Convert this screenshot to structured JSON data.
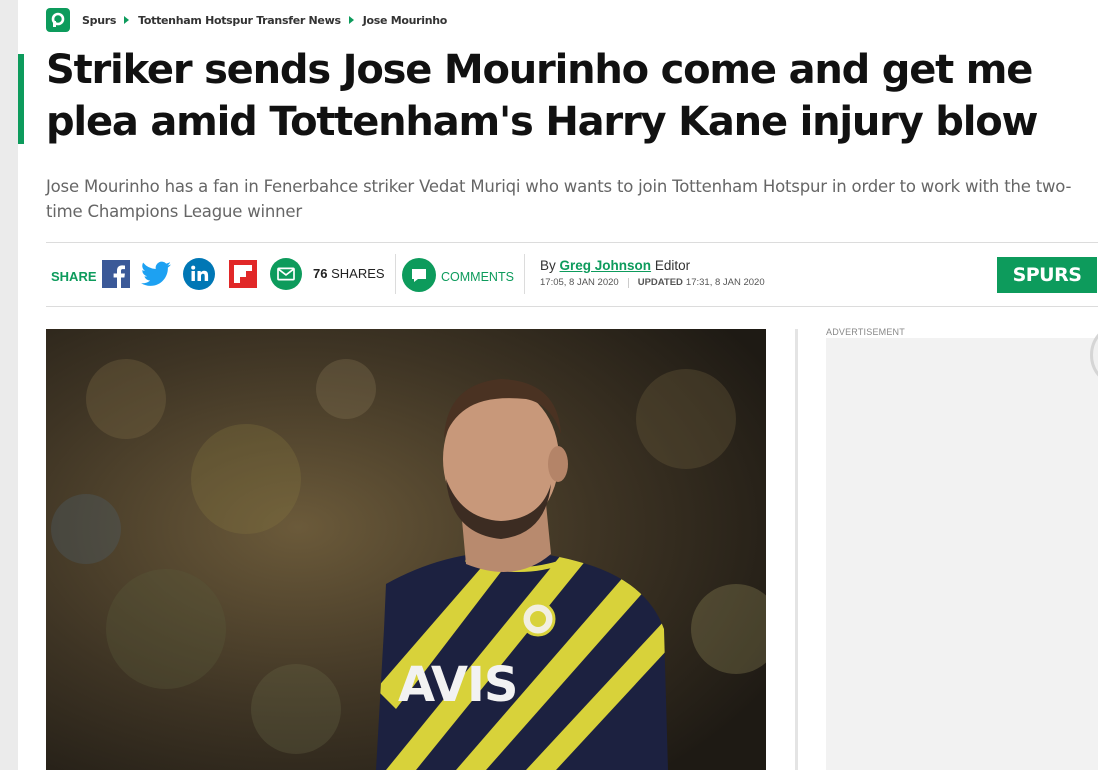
{
  "breadcrumb": {
    "items": [
      "Spurs",
      "Tottenham Hotspur Transfer News",
      "Jose Mourinho"
    ]
  },
  "article": {
    "headline": "Striker sends Jose Mourinho come and get me plea amid Tottenham's Harry Kane injury blow",
    "standfirst": "Jose Mourinho has a fan in Fenerbahce striker Vedat Muriqi who wants to join Tottenham Hotspur in order to work with the two-time Champions League winner"
  },
  "share": {
    "label": "SHARE",
    "count": "76",
    "count_suffix": "SHARES",
    "comments_label": "COMMENTS",
    "icons": [
      "facebook-icon",
      "twitter-icon",
      "linkedin-icon",
      "flipboard-icon",
      "email-icon"
    ]
  },
  "byline": {
    "prefix": "By",
    "author": "Greg Johnson",
    "role": "Editor",
    "published": "17:05, 8 JAN 2020",
    "updated_label": "UPDATED",
    "updated": "17:31, 8 JAN 2020"
  },
  "badge": "SPURS",
  "sidebar": {
    "ad_label": "ADVERTISEMENT"
  },
  "hero_image": {
    "shirt_text": "AVIS"
  },
  "colors": {
    "brand": "#0d9b5c",
    "facebook": "#3b5998",
    "twitter": "#1da1f2",
    "linkedin": "#0077b5",
    "flipboard": "#e12828"
  }
}
